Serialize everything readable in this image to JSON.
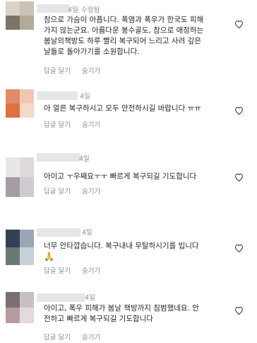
{
  "comments": [
    {
      "time": "4일",
      "edited": "· 수정됨",
      "text": "참으로 가슴이 아픕니다. 폭염과 폭우가 한국도 피해\n가지 않는군요. 아름다운 봉수골도, 참으로 애정하는\n봄날의책방도 하루 빨리 복구되어 느리고 사려 깊은\n날들로 돌아가기를 소원합니다.",
      "reply": "답글 달기",
      "hide": "숨기기",
      "avatar_colors": [
        "#d9d2c7",
        "#c9c2b6",
        "#7d7467",
        "#b2a999"
      ]
    },
    {
      "time": "4일",
      "text": "아 얼른 복구하시고 모두 안전하시길 바랍니다 ㅠㅠ",
      "reply": "답글 달기",
      "hide": "숨기기",
      "avatar_colors": [
        "#e28a6a",
        "#f0c7b3",
        "#e0703f",
        "#f3d9ca"
      ]
    },
    {
      "time": "4일",
      "text": "아이고 ㅜ우째요ㅜㅜ 빠르게 복구되길 기도합니다",
      "reply": "답글 달기",
      "hide": "숨기기",
      "avatar_colors": [
        "#e9e6e8",
        "#ddd9dc",
        "#a49ea4",
        "#cfcbd0"
      ]
    },
    {
      "time": "4일",
      "text": "너무 안타깝습니다. 복구내내 무탈하시기를 빕니다",
      "emoji": "🙏",
      "reply": "답글 달기",
      "hide": "숨기기",
      "avatar_colors": [
        "#334055",
        "#9aa8b5",
        "#677a74",
        "#c7d0d4"
      ]
    },
    {
      "time": "4일",
      "text": "아이고, 폭우 피해가 봄날 책방까지 침범했네요. 안\n전하고 빠르게 복구되길 기도합니다",
      "reply": "답글 달기",
      "hide": "숨기기",
      "avatar_colors": [
        "#7b6f72",
        "#c7bfc0",
        "#b89aa1",
        "#e2dadb"
      ]
    }
  ],
  "icons": {
    "like": "heart-outline-icon"
  }
}
